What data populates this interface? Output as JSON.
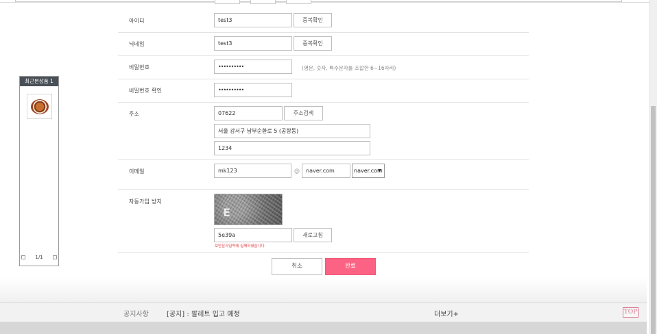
{
  "form": {
    "id": {
      "label": "아이디",
      "value": "test3",
      "button": "중복확인"
    },
    "nickname": {
      "label": "닉네임",
      "value": "test3",
      "button": "중복확인"
    },
    "password": {
      "label": "비밀번호",
      "value": "••••••••••",
      "hint": "(영문, 숫자, 특수문자를 조합한 6~16자리)"
    },
    "password_confirm": {
      "label": "비밀번호 확인",
      "value": "••••••••••"
    },
    "address": {
      "label": "주소",
      "zipcode": "07622",
      "search_button": "주소검색",
      "address1": "서울 강서구 남부순환로 5 (공항동)",
      "address2": "1234"
    },
    "email": {
      "label": "이메일",
      "local": "mk123",
      "at": "@",
      "domain": "naver.com",
      "select_value": "naver.com",
      "select_caret": "▼"
    },
    "captcha": {
      "label": "자동가입 방지",
      "image_letter": "E",
      "value": "5e39a",
      "refresh_button": "새로고침",
      "error": "보안문자입력에 실패하였습니다."
    }
  },
  "actions": {
    "cancel": "취소",
    "submit": "완료"
  },
  "recent": {
    "title": "최근본상품 1",
    "pager": "1/1"
  },
  "footer": {
    "notice_label": "공지사항",
    "notice_text": "[공지] : 팔레트 입고 예정",
    "more": "더보기+",
    "top": "TOP"
  },
  "colors": {
    "primary": "#fb6283",
    "error": "#e0393e",
    "widget_header": "#4a5057"
  }
}
